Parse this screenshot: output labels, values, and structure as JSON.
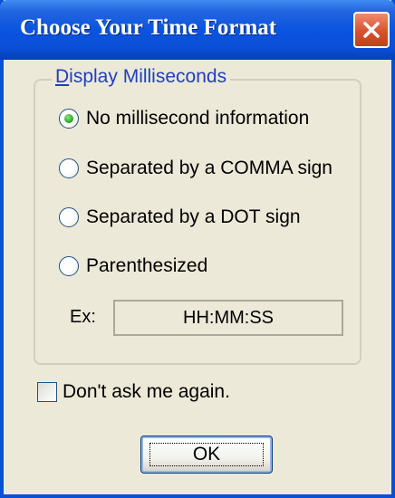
{
  "window": {
    "title": "Choose Your Time Format",
    "title_bar_color": "#0a4fd8",
    "close_icon": "close-icon",
    "close_button_color": "#d8512e"
  },
  "group": {
    "legend_accel": "D",
    "legend_rest": "isplay Milliseconds",
    "legend_color": "#1f3fbf"
  },
  "options": [
    {
      "label": "No millisecond information",
      "selected": true
    },
    {
      "label": "Separated by a COMMA sign",
      "selected": false
    },
    {
      "label": "Separated by a DOT sign",
      "selected": false
    },
    {
      "label": "Parenthesized",
      "selected": false
    }
  ],
  "example": {
    "label": "Ex:",
    "value": "HH:MM:SS"
  },
  "dont_ask": {
    "label": "Don't ask me again.",
    "checked": false
  },
  "buttons": {
    "ok_label": "OK"
  }
}
